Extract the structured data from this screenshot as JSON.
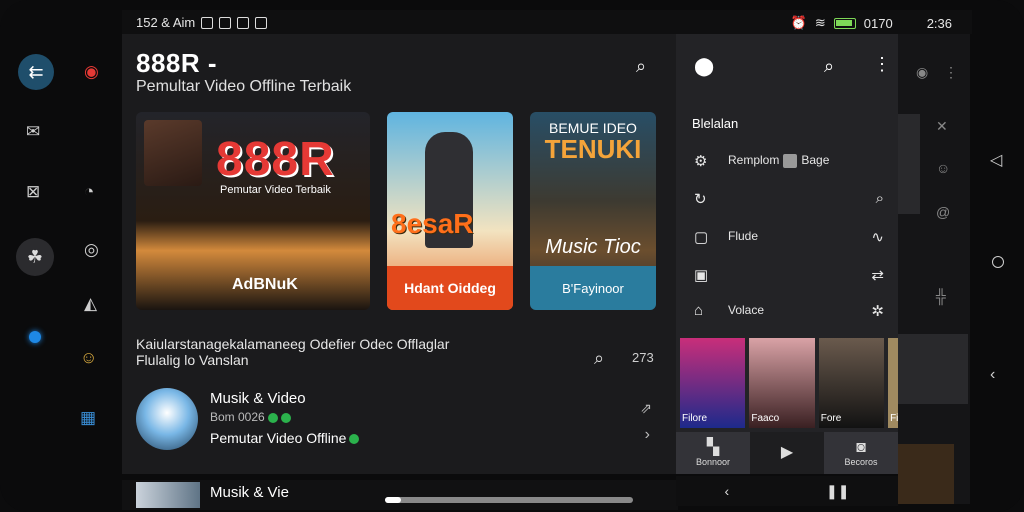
{
  "status_bar": {
    "left_text": "152 & Aim",
    "battery_text": "0170",
    "time": "2:36",
    "battery_color": "#7ed957"
  },
  "colors": {
    "accent": "#1f4e6b",
    "brand_red": "#e53935",
    "orange": "#e2491c",
    "teal": "#2a7c9e"
  },
  "rail": {
    "items": [
      {
        "icon": "menu-icon"
      },
      {
        "icon": "mail-icon"
      },
      {
        "icon": "inbox-icon"
      },
      {
        "icon": "group-icon"
      },
      {
        "icon": "dot-indicator"
      }
    ]
  },
  "header": {
    "title": "888R -",
    "subtitle": "Pemultar Video Offline Terbaik"
  },
  "cards": [
    {
      "big": "888R",
      "tag": "Pemutar Video Terbaik",
      "label": "AdBNuK"
    },
    {
      "big": "8esaR",
      "label": "Hdant Oiddeg"
    },
    {
      "head": "BEMUE IDEO",
      "big": "TENUKI",
      "mid": "Music Tioc",
      "label": "B'Fayinoor"
    }
  ],
  "section": {
    "text_line1": "Kaiularstanagekalamaneeg Odefier Odec Offlaglar",
    "text_line2": "Flulalig lo Vanslan",
    "count": "273"
  },
  "list_item": {
    "title": "Musik & Video",
    "meta": "Bom 0026",
    "subtitle": "Pemutar Video Offline"
  },
  "bottom_item": {
    "title": "Musik & Vie"
  },
  "panel": {
    "heading": "Blelalan",
    "rows": [
      {
        "icon": "settings-icon",
        "label": "Remplom",
        "badge": "Bage",
        "right_icon": ""
      },
      {
        "icon": "refresh-icon",
        "label": "",
        "right_icon": "search-icon"
      },
      {
        "icon": "folder-icon",
        "label": "Flude",
        "right_icon": "wave-icon"
      },
      {
        "icon": "square-icon",
        "label": "",
        "right_icon": "sync-icon"
      },
      {
        "icon": "home-icon",
        "label": "Volace",
        "right_icon": "gear-icon"
      }
    ],
    "thumbs": [
      "Filore",
      "Faaco",
      "Fore",
      "Fi"
    ],
    "buttons": [
      {
        "icon": "gallery-icon",
        "label": "Bonnoor"
      },
      {
        "icon": "play-icon",
        "label": ""
      },
      {
        "icon": "camera-icon",
        "label": "Becoros"
      }
    ]
  }
}
